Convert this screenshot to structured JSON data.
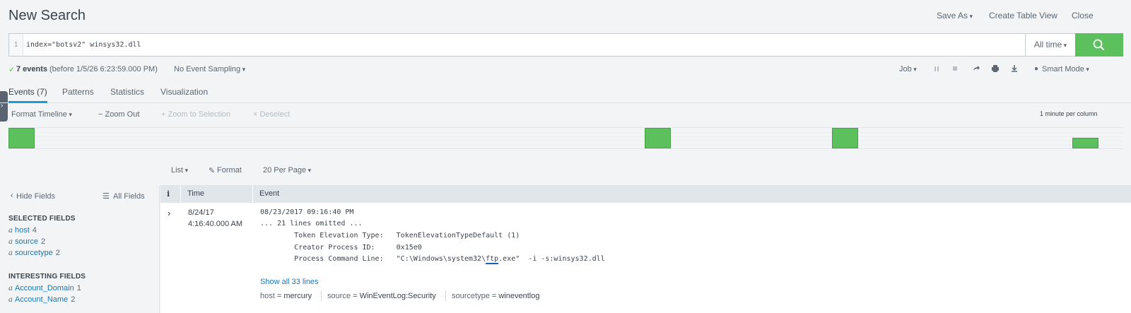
{
  "header": {
    "title": "New Search",
    "save_as": "Save As",
    "create_table_view": "Create Table View",
    "close": "Close"
  },
  "search": {
    "line_number": "1",
    "query": "index=\"botsv2\" winsys32.dll",
    "time_range": "All time"
  },
  "status": {
    "check": "✓",
    "event_count": "7 events",
    "before": "(before 1/5/26 6:23:59.000 PM)",
    "sampling": "No Event Sampling",
    "job": "Job",
    "mode": "Smart Mode"
  },
  "tabs": [
    {
      "label": "Events (7)",
      "active": true
    },
    {
      "label": "Patterns"
    },
    {
      "label": "Statistics"
    },
    {
      "label": "Visualization"
    }
  ],
  "timeline": {
    "format": "Format Timeline",
    "zoom_out": "− Zoom Out",
    "zoom_selection": "+ Zoom to Selection",
    "deselect": "× Deselect",
    "scale": "1 minute per column",
    "buckets": [
      {
        "position": 0.0,
        "level": 1.0
      },
      {
        "position": 0.585,
        "level": 1.0
      },
      {
        "position": 0.757,
        "level": 1.0
      },
      {
        "position": 0.978,
        "level": 0.5
      }
    ]
  },
  "results": {
    "list": "List",
    "format": "Format",
    "per_page": "20 Per Page"
  },
  "sidebar": {
    "hide_fields": "Hide Fields",
    "all_fields": "All Fields",
    "selected_heading": "SELECTED FIELDS",
    "selected": [
      {
        "type": "a",
        "name": "host",
        "count": "4"
      },
      {
        "type": "a",
        "name": "source",
        "count": "2"
      },
      {
        "type": "a",
        "name": "sourcetype",
        "count": "2"
      }
    ],
    "interesting_heading": "INTERESTING FIELDS",
    "interesting": [
      {
        "type": "a",
        "name": "Account_Domain",
        "count": "1"
      },
      {
        "type": "a",
        "name": "Account_Name",
        "count": "2"
      }
    ]
  },
  "table": {
    "col_info": "i",
    "col_time": "Time",
    "col_event": "Event",
    "row": {
      "date": "8/24/17",
      "time": "4:16:40.000 AM",
      "lines": [
        "08/23/2017 09:16:40 PM",
        "... 21 lines omitted ...",
        "        Token Elevation Type:   TokenElevationTypeDefault (1)",
        "        Creator Process ID:     0x15e0"
      ],
      "cmd_prefix": "        Process Command Line:   \"C:\\Windows\\system32\\",
      "cmd_highlight": "ftp",
      "cmd_suffix": ".exe\"  -i -s:winsys32.dll",
      "show_all": "Show all 33 lines",
      "kv": [
        {
          "key": "host",
          "value": "mercury"
        },
        {
          "key": "source",
          "value": "WinEventLog:Security"
        },
        {
          "key": "sourcetype",
          "value": "wineventlog"
        }
      ]
    }
  },
  "colors": {
    "accent": "#1a9cce",
    "link": "#1a78b4",
    "success": "#5cc05c"
  }
}
